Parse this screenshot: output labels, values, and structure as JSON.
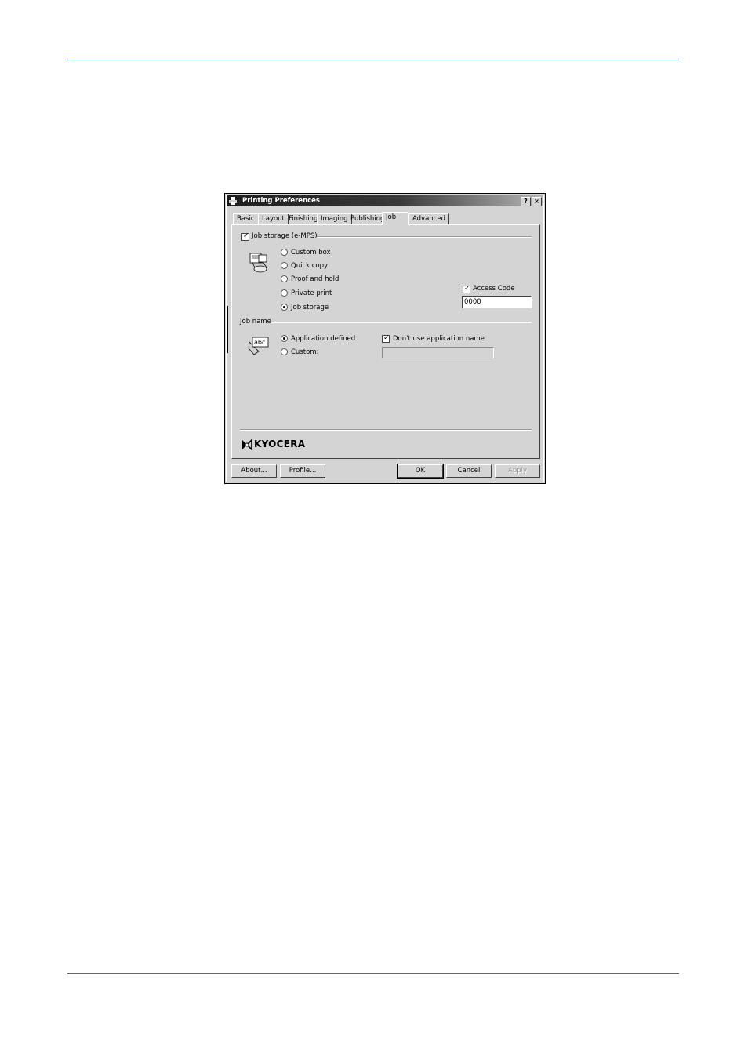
{
  "dialog": {
    "title": "Printing Preferences",
    "help_btn": "?",
    "close_btn": "×",
    "tabs": [
      {
        "label": "Basic"
      },
      {
        "label": "Layout"
      },
      {
        "label": "Finishing"
      },
      {
        "label": "Imaging"
      },
      {
        "label": "Publishing"
      },
      {
        "label": "Job",
        "active": true
      },
      {
        "label": "Advanced"
      }
    ],
    "job_storage": {
      "checkbox_label": "Job storage (e-MPS)",
      "checked": true,
      "options": [
        {
          "label": "Custom box",
          "selected": false
        },
        {
          "label": "Quick copy",
          "selected": false
        },
        {
          "label": "Proof and hold",
          "selected": false
        },
        {
          "label": "Private print",
          "selected": false
        },
        {
          "label": "Job storage",
          "selected": true
        }
      ],
      "access_code": {
        "label": "Access Code",
        "checked": true,
        "value": "0000"
      }
    },
    "job_name": {
      "section_label": "Job name",
      "options": [
        {
          "label": "Application defined",
          "selected": true
        },
        {
          "label": "Custom:",
          "selected": false
        }
      ],
      "dont_use_app_name": {
        "label": "Don't use application name",
        "checked": true
      },
      "custom_value": ""
    },
    "brand": "KYOCERA",
    "buttons": {
      "about": "About...",
      "profile": "Profile...",
      "ok": "OK",
      "cancel": "Cancel",
      "apply": "Apply"
    }
  }
}
